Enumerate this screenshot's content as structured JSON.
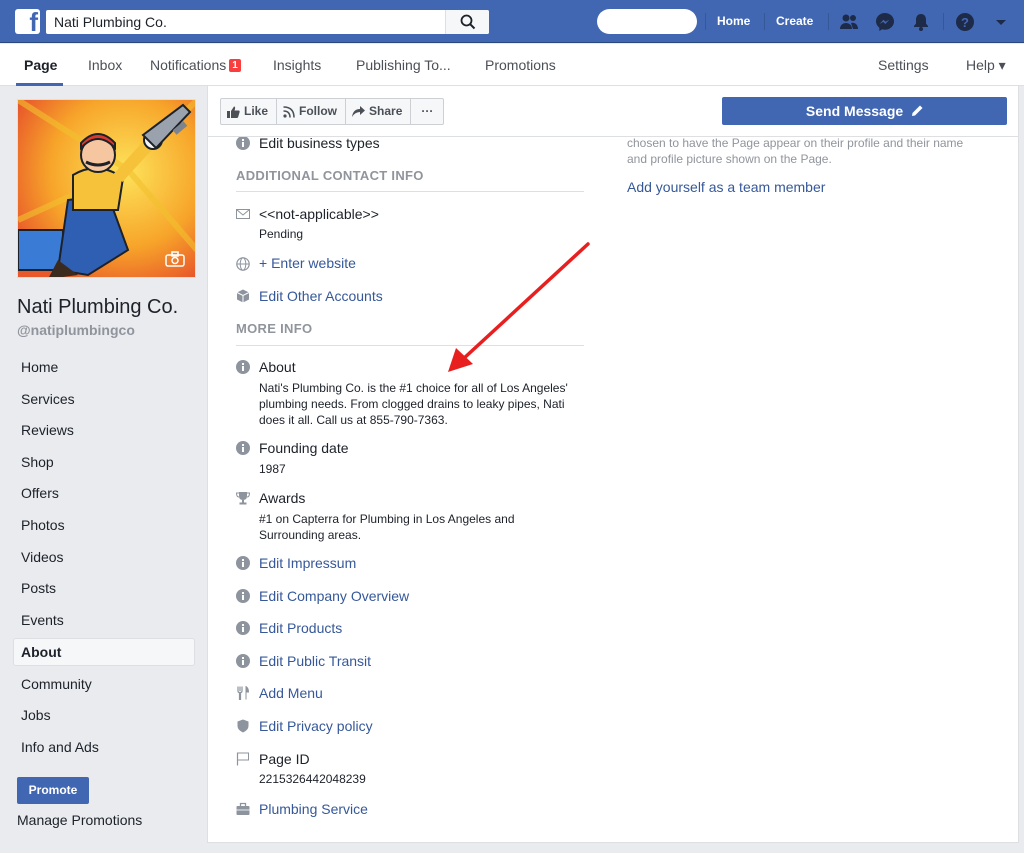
{
  "topbar": {
    "search_value": "Nati Plumbing Co.",
    "links": [
      "Home",
      "Create"
    ],
    "colors": {
      "bar": "#4267b2",
      "accent": "#365899"
    }
  },
  "pagenav": {
    "items": [
      "Page",
      "Inbox",
      "Notifications",
      "Insights",
      "Publishing To...",
      "Promotions",
      "Settings",
      "Help ▾"
    ],
    "notifications_badge": "1"
  },
  "sidebar": {
    "page_name": "Nati Plumbing Co.",
    "handle": "@natiplumbingco",
    "items": [
      "Home",
      "Services",
      "Reviews",
      "Shop",
      "Offers",
      "Photos",
      "Videos",
      "Posts",
      "Events",
      "About",
      "Community",
      "Jobs",
      "Info and Ads"
    ],
    "active": "About",
    "promote_label": "Promote",
    "manage_label": "Manage Promotions"
  },
  "actions": {
    "like": "Like",
    "follow": "Follow",
    "share": "Share",
    "more": "···",
    "send_message": "Send Message"
  },
  "content": {
    "edit_business_types": "Edit business types",
    "additional_contact_header": "ADDITIONAL CONTACT INFO",
    "email_value": "<<not-applicable>>",
    "email_status": "Pending",
    "enter_website": "+ Enter website",
    "edit_other_accounts": "Edit Other Accounts",
    "more_info_header": "MORE INFO",
    "about_title": "About",
    "about_line1": "Nati's Plumbing Co. is the #1 choice for all of Los Angeles'",
    "about_line2": "plumbing needs. From clogged drains to leaky pipes, Nati",
    "about_line3": "does it all. Call us at 855-790-7363.",
    "founding_title": "Founding date",
    "founding_value": "1987",
    "awards_title": "Awards",
    "awards_line1": "#1 on Capterra for Plumbing in Los Angeles and",
    "awards_line2": "Surrounding areas.",
    "edit_impressum": "Edit Impressum",
    "edit_company_overview": "Edit Company Overview",
    "edit_products": "Edit Products",
    "edit_public_transit": "Edit Public Transit",
    "add_menu": "Add Menu",
    "edit_privacy": "Edit Privacy policy",
    "page_id_title": "Page ID",
    "page_id_value": "2215326442048239",
    "category": "Plumbing Service"
  },
  "right": {
    "note_line1": "chosen to have the Page appear on their profile and their name",
    "note_line2": "and profile picture shown on the Page.",
    "add_team": "Add yourself as a team member"
  }
}
